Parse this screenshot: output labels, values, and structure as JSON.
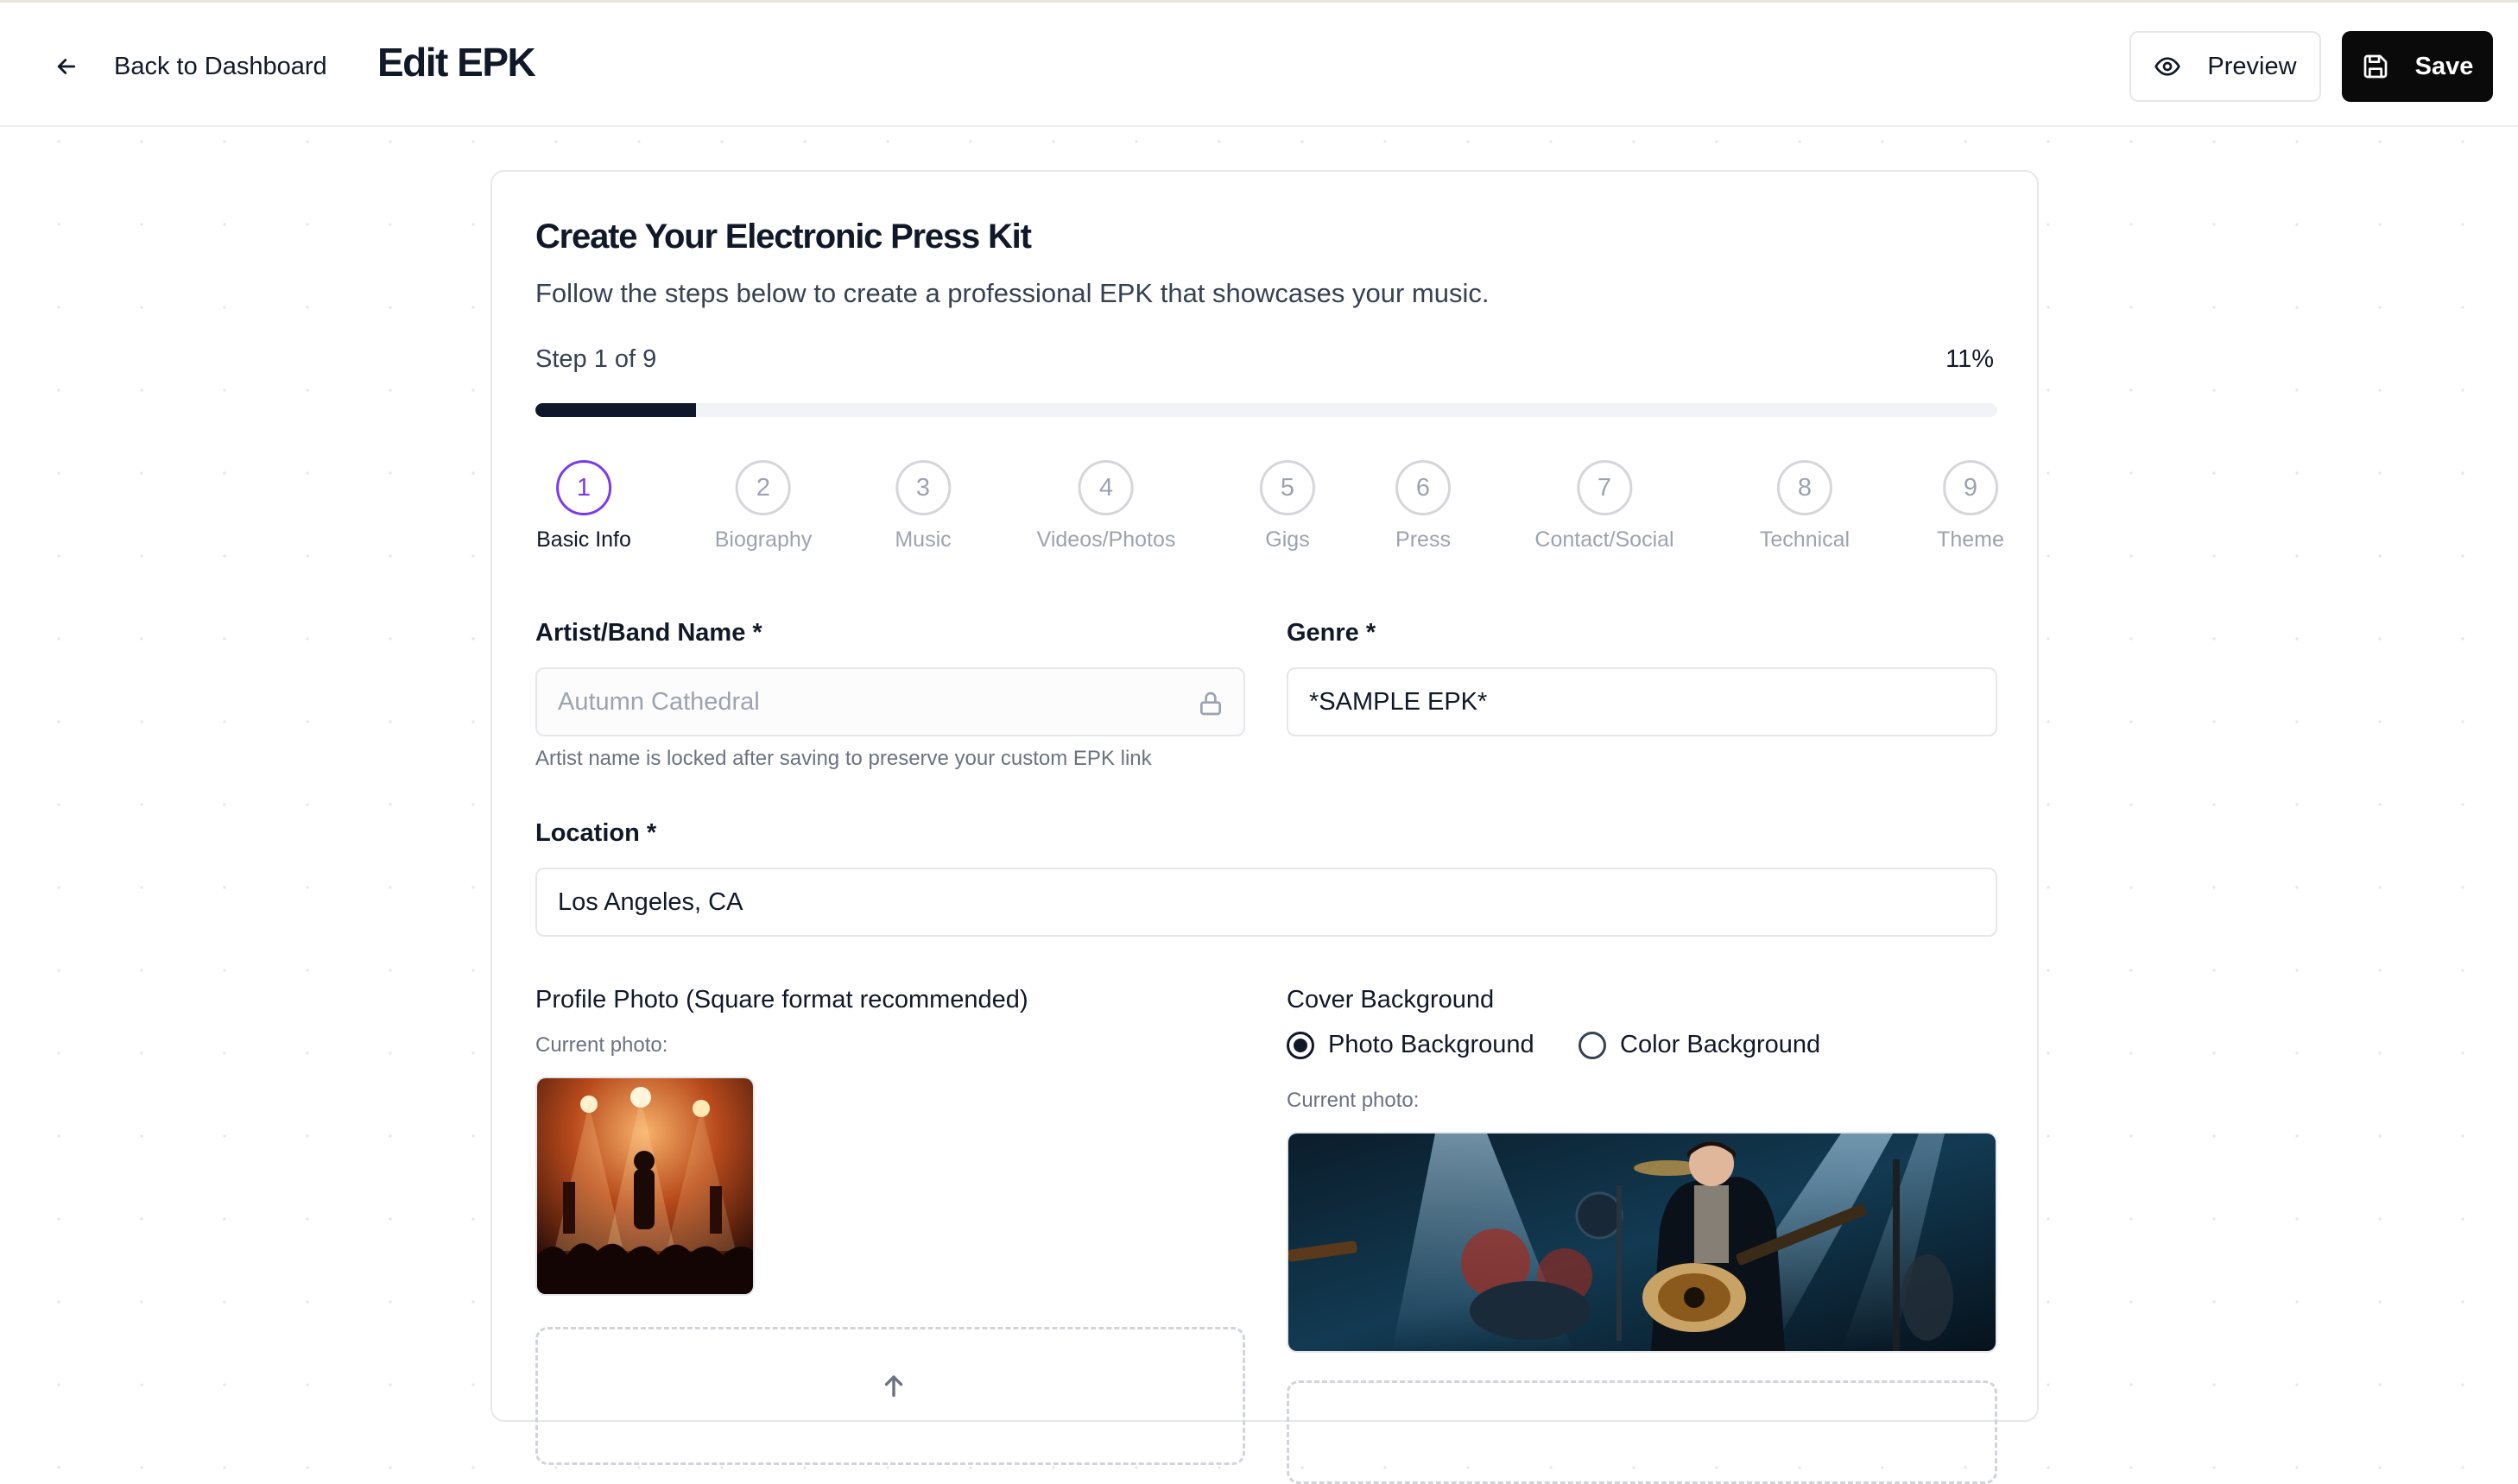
{
  "header": {
    "back_label": "Back to Dashboard",
    "title": "Edit EPK",
    "preview_label": "Preview",
    "save_label": "Save"
  },
  "card": {
    "title": "Create Your Electronic Press Kit",
    "subtitle": "Follow the steps below to create a professional EPK that showcases your music.",
    "step_label": "Step 1 of 9",
    "progress_percent_label": "11%",
    "progress_fraction": 0.11
  },
  "steps": [
    {
      "number": "1",
      "label": "Basic Info",
      "active": true
    },
    {
      "number": "2",
      "label": "Biography",
      "active": false
    },
    {
      "number": "3",
      "label": "Music",
      "active": false
    },
    {
      "number": "4",
      "label": "Videos/Photos",
      "active": false
    },
    {
      "number": "5",
      "label": "Gigs",
      "active": false
    },
    {
      "number": "6",
      "label": "Press",
      "active": false
    },
    {
      "number": "7",
      "label": "Contact/Social",
      "active": false
    },
    {
      "number": "8",
      "label": "Technical",
      "active": false
    },
    {
      "number": "9",
      "label": "Theme",
      "active": false
    }
  ],
  "form": {
    "artist_name": {
      "label": "Artist/Band Name *",
      "value": "Autumn Cathedral",
      "hint": "Artist name is locked after saving to preserve your custom EPK link"
    },
    "genre": {
      "label": "Genre *",
      "value": "*SAMPLE EPK*"
    },
    "location": {
      "label": "Location *",
      "value": "Los Angeles, CA"
    },
    "profile_photo": {
      "label": "Profile Photo (Square format recommended)",
      "current_label": "Current photo:"
    },
    "cover_background": {
      "label": "Cover Background",
      "options": [
        {
          "label": "Photo Background",
          "selected": true
        },
        {
          "label": "Color Background",
          "selected": false
        }
      ],
      "current_label": "Current photo:"
    }
  },
  "icons": {
    "back": "arrow-left-icon",
    "preview": "eye-icon",
    "save": "floppy-disk-icon",
    "locked": "lock-icon",
    "upload": "arrow-up-icon"
  },
  "colors": {
    "accent": "#7c3aed",
    "primary_button": "#0a0a0a",
    "progress_fill": "#0f172a"
  }
}
